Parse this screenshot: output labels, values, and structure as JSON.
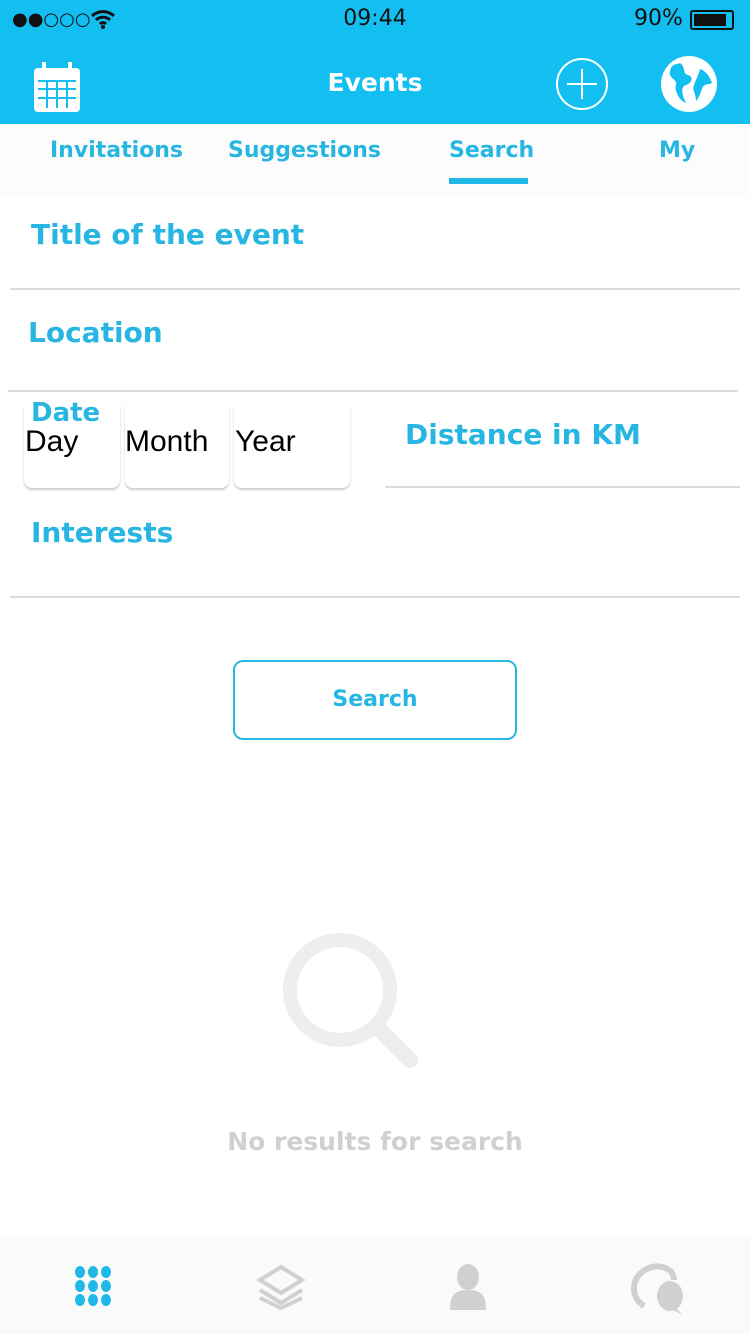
{
  "status": {
    "signal": "●●○○○",
    "time": "09:44",
    "battery": "90%"
  },
  "header": {
    "title": "Events",
    "left_icon": "calendar-icon",
    "right_icons": [
      "plus-circle-icon",
      "globe-icon"
    ],
    "color": "#13bff1"
  },
  "tabs": [
    {
      "label": "Invitations"
    },
    {
      "label": "Suggestions"
    },
    {
      "label": "Search",
      "active": true
    },
    {
      "label": "My"
    }
  ],
  "form": {
    "title_label": "Title of the event",
    "location_label": "Location",
    "date_label": "Date",
    "day": "Day",
    "month": "Month",
    "year": "Year",
    "distance_label": "Distance in KM",
    "interests_label": "Interests",
    "search_button": "Search"
  },
  "empty": {
    "icon": "search-icon",
    "text": "No results for search"
  },
  "tabbar": [
    {
      "icon": "grid-icon",
      "active": true
    },
    {
      "icon": "layers-icon"
    },
    {
      "icon": "person-icon"
    },
    {
      "icon": "chat-icon"
    }
  ]
}
